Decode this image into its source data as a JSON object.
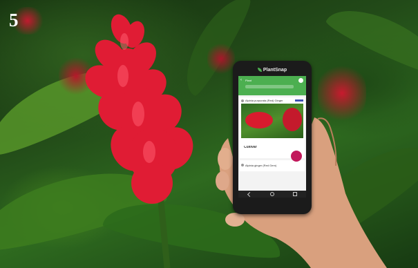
{
  "page_number": "5",
  "phone": {
    "app_name": "PlantSnap",
    "search_label": "Plant",
    "result_1_name": "Alpinia purpurata (Red) Ginger",
    "photo_caption": "Cultivar",
    "result_2_name": "Alpinia ginger (Red Gem)"
  },
  "colors": {
    "flower_red": "#e01c34",
    "app_green": "#4caf50",
    "fab_pink": "#c2185b"
  }
}
